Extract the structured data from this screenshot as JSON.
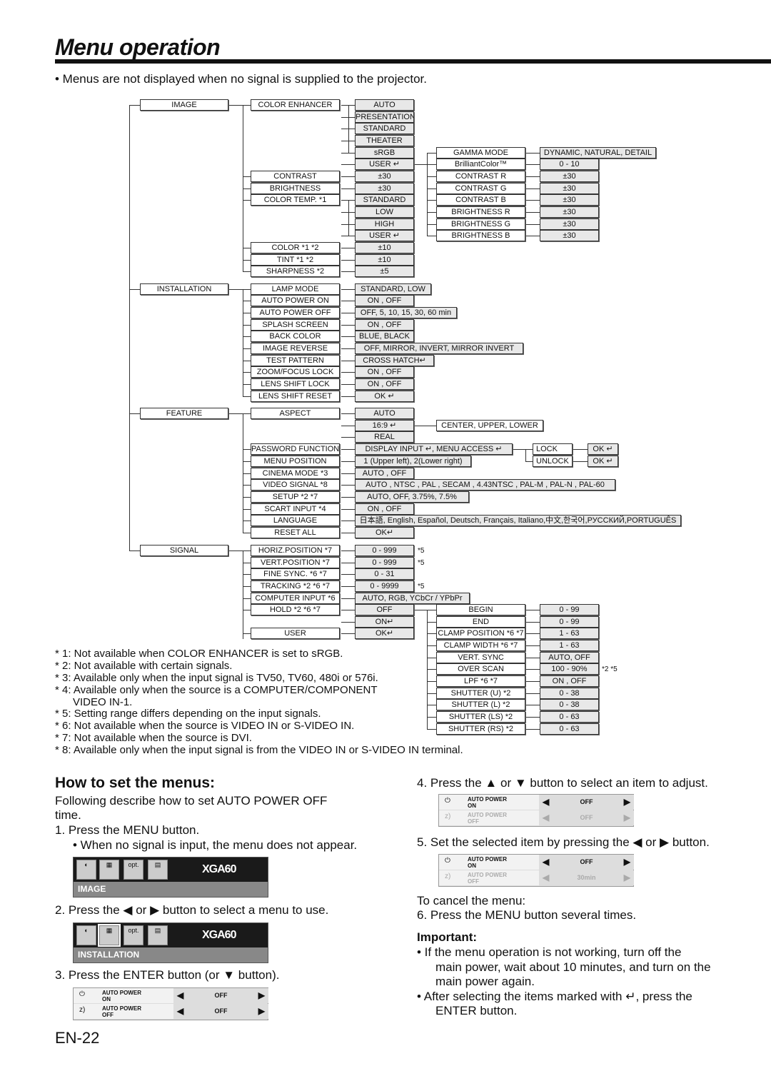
{
  "title": "Menu operation",
  "intro": "•  Menus are not displayed when no signal is supplied to the projector.",
  "diagram": {
    "boxes": [
      "IMAGE",
      "INSTALLATION",
      "FEATURE",
      "SIGNAL",
      "COLOR ENHANCER",
      "CONTRAST",
      "BRIGHTNESS",
      "COLOR TEMP.   *1",
      "COLOR    *1 *2",
      "TINT     *1 *2",
      "SHARPNESS    *2",
      "LAMP MODE",
      "AUTO POWER ON",
      "AUTO POWER OFF",
      "SPLASH SCREEN",
      "BACK COLOR",
      "IMAGE REVERSE",
      "TEST PATTERN",
      "ZOOM/FOCUS LOCK",
      "LENS SHIFT LOCK",
      "LENS SHIFT RESET",
      "ASPECT",
      "PASSWORD FUNCTION",
      "MENU POSITION",
      "CINEMA MODE  *3",
      "VIDEO SIGNAL  *8",
      "SETUP    *2 *7",
      "SCART INPUT  *4",
      "LANGUAGE",
      "RESET ALL",
      "HORIZ.POSITION   *7",
      "VERT.POSITION    *7",
      "FINE SYNC.  *6 *7",
      "TRACKING  *2 *6 *7",
      "COMPUTER INPUT    *6",
      "HOLD    *2 *6 *7",
      "USER",
      "AUTO",
      "PRESENTATION",
      "STANDARD",
      "THEATER",
      "sRGB",
      "USER ↵",
      "±30",
      "±30",
      "STANDARD",
      "LOW",
      "HIGH",
      "USER ↵",
      "±10",
      "±10",
      "±5",
      "STANDARD, LOW",
      "ON , OFF",
      "OFF,  5,  10,  15,  30,  60 min",
      "ON , OFF",
      "BLUE, BLACK",
      "OFF, MIRROR, INVERT, MIRROR INVERT",
      "CROSS HATCH↵",
      "ON , OFF",
      "ON , OFF",
      "OK ↵",
      "AUTO",
      "16:9 ↵",
      "REAL",
      "DISPLAY INPUT ↵, MENU ACCESS ↵",
      "1 (Upper left), 2(Lower right)",
      "AUTO , OFF",
      "AUTO , NTSC , PAL , SECAM , 4.43NTSC , PAL-M , PAL-N , PAL-60",
      "AUTO, OFF, 3.75%, 7.5%",
      "ON , OFF",
      "日本語, English, Español, Deutsch, Français, Italiano,中文,한국어,РУССКИЙ,PORTUGUÊS",
      "OK↵",
      "0 - 999",
      "0 - 999",
      "0 - 31",
      "0 - 9999",
      "AUTO, RGB, YCbCr / YPbPr",
      "OFF",
      "ON↵",
      "OK↵",
      "GAMMA MODE",
      "BrilliantColor™",
      "CONTRAST R",
      "CONTRAST G",
      "CONTRAST B",
      "BRIGHTNESS R",
      "BRIGHTNESS G",
      "BRIGHTNESS B",
      "CENTER, UPPER, LOWER",
      "LOCK",
      "UNLOCK",
      "BEGIN",
      "END",
      "CLAMP POSITION *6 *7",
      "CLAMP WIDTH  *6 *7",
      "VERT. SYNC",
      "OVER SCAN",
      "LPF       *6 *7",
      "SHUTTER (U)   *2",
      "SHUTTER (L)    *2",
      "SHUTTER (LS)   *2",
      "SHUTTER (RS)   *2",
      "DYNAMIC, NATURAL, DETAIL",
      "0 - 10",
      "±30",
      "±30",
      "±30",
      "±30",
      "±30",
      "±30",
      "OK ↵",
      "OK ↵",
      "0 - 99",
      "0 - 99",
      "1 - 63",
      "1 - 63",
      "AUTO, OFF",
      "100 - 90%",
      "ON , OFF",
      "0 - 38",
      "0 - 38",
      "0 - 63",
      "0 - 63"
    ],
    "notes": [
      "*5",
      "*5",
      "*5",
      "*2 *5"
    ]
  },
  "footnotes": [
    "* 1: Not available when COLOR ENHANCER is set to sRGB.",
    "* 2: Not available with certain signals.",
    "* 3: Available only when the input signal is TV50, TV60, 480i or 576i.",
    "* 4: Available only when the source is a COMPUTER/COMPONENT",
    "      VIDEO IN-1.",
    "* 5: Setting range differs depending on the input signals.",
    "* 6: Not available when the source is VIDEO IN or S-VIDEO IN.",
    "* 7: Not available when the source is DVI.",
    "* 8: Available only when the input signal is from the VIDEO IN or S-VIDEO IN terminal."
  ],
  "howto": {
    "heading": "How to set the menus:",
    "desc1": "Following describe how to set AUTO POWER OFF",
    "desc2": "time.",
    "step1": "1.  Press the MENU button.",
    "step1_note": "•   When no signal is input, the menu does not appear.",
    "step2": "2.  Press the ◀ or ▶ button to select a menu to use.",
    "step3": "3.  Press the ENTER button (or ▼ button).",
    "step4": "4.  Press the ▲ or ▼ button to select an item to adjust.",
    "step5": "5.  Set the selected item by pressing the ◀ or ▶ button.",
    "cancel": "To cancel the menu:",
    "step6": "6.  Press the MENU button several times.",
    "important": "Important:",
    "imp1a": "•   If the menu operation is not working, turn off the",
    "imp1b": "main power, wait about 10 minutes, and turn on the",
    "imp1c": "main power again.",
    "imp2a": "•   After selecting the items marked with ↵, press the",
    "imp2b": "ENTER button."
  },
  "menu_screens": {
    "model": "XGA60",
    "opt": "opt.",
    "screen1_label": "IMAGE",
    "screen2_label": "INSTALLATION",
    "item1": "AUTO POWER\nON",
    "item2": "AUTO POWER\nOFF",
    "off": "OFF",
    "min30": "30min"
  },
  "page_number": "EN-22"
}
